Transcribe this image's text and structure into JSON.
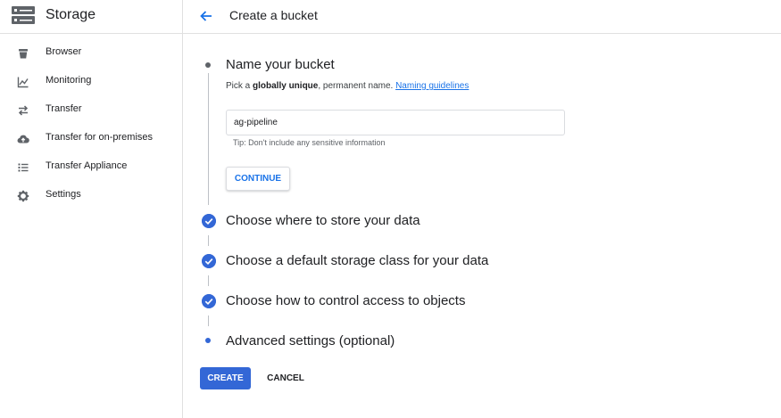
{
  "app": {
    "title": "Storage",
    "icon": "storage-icon"
  },
  "sidebar": {
    "items": [
      {
        "label": "Browser",
        "icon": "bucket-icon"
      },
      {
        "label": "Monitoring",
        "icon": "chart-icon"
      },
      {
        "label": "Transfer",
        "icon": "transfer-arrows-icon"
      },
      {
        "label": "Transfer for on-premises",
        "icon": "cloud-upload-icon"
      },
      {
        "label": "Transfer Appliance",
        "icon": "appliance-list-icon"
      },
      {
        "label": "Settings",
        "icon": "gear-icon"
      }
    ]
  },
  "header": {
    "back_icon": "back-arrow-icon",
    "title": "Create a bucket"
  },
  "steps": {
    "name": {
      "title": "Name your bucket",
      "desc_pre": "Pick a ",
      "desc_bold": "globally unique",
      "desc_post": ", permanent name. ",
      "desc_link": "Naming guidelines",
      "input_value": "ag-pipeline",
      "tip": "Tip: Don't include any sensitive information",
      "continue_label": "CONTINUE"
    },
    "location": {
      "title": "Choose where to store your data",
      "status": "completed"
    },
    "storage_class": {
      "title": "Choose a default storage class for your data",
      "status": "completed"
    },
    "access": {
      "title": "Choose how to control access to objects",
      "status": "completed"
    },
    "advanced": {
      "title": "Advanced settings (optional)"
    }
  },
  "actions": {
    "create_label": "CREATE",
    "cancel_label": "CANCEL"
  },
  "colors": {
    "accent": "#1a73e8",
    "primary_button": "#3367d6",
    "check": "#3367d6",
    "text": "#202124",
    "divider": "#e0e0e0"
  }
}
